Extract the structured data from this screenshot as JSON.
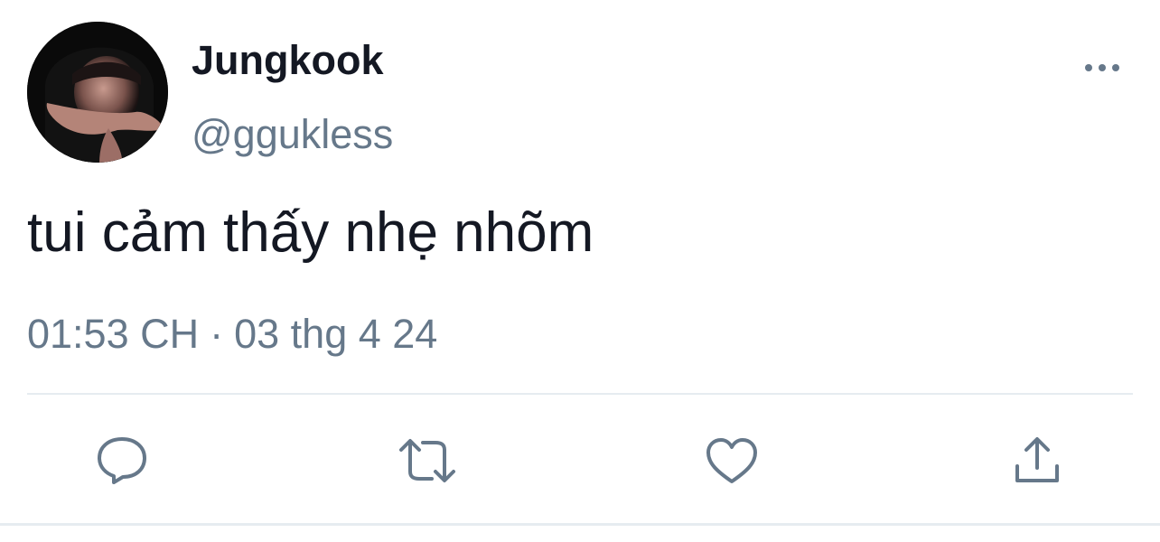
{
  "tweet": {
    "display_name": "Jungkook",
    "handle": "@ggukless",
    "text": "tui cảm thấy nhẹ nhõm",
    "time": "01:53 CH",
    "separator": "·",
    "date": "03 thg 4 24"
  },
  "icons": {
    "more": "more-horizontal-icon",
    "reply": "reply-icon",
    "retweet": "retweet-icon",
    "like": "heart-icon",
    "share": "share-icon"
  },
  "colors": {
    "text_primary": "#141823",
    "text_secondary": "#66788a",
    "icon": "#66788a",
    "divider": "#e6ecf0"
  }
}
